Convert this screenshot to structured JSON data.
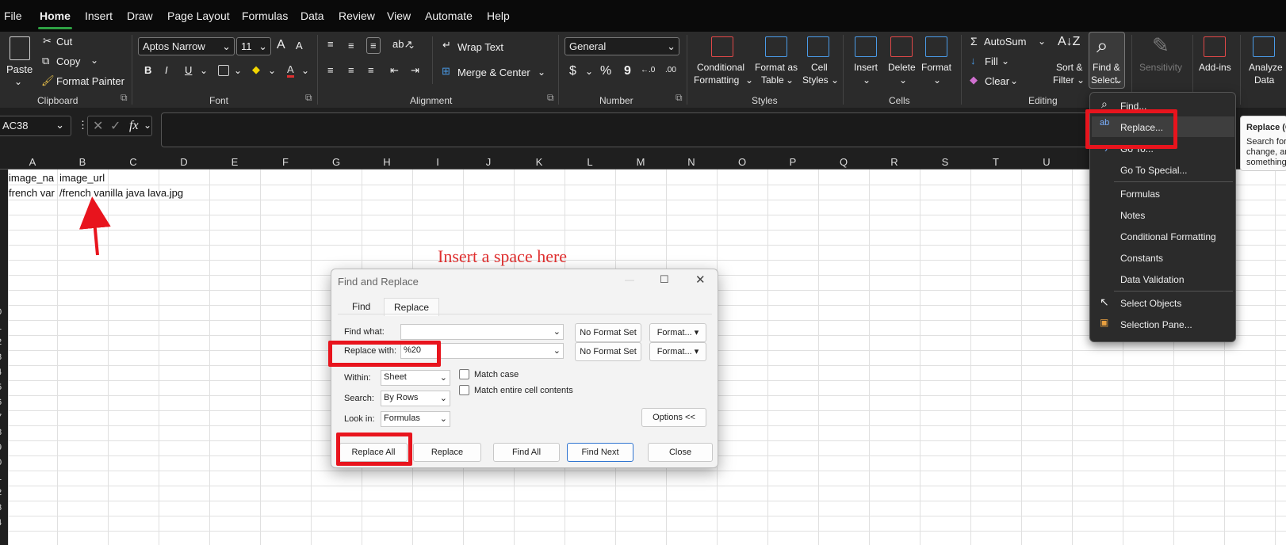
{
  "menu": [
    "File",
    "Home",
    "Insert",
    "Draw",
    "Page Layout",
    "Formulas",
    "Data",
    "Review",
    "View",
    "Automate",
    "Help"
  ],
  "clipboard": {
    "paste": "Paste",
    "cut": "Cut",
    "copy": "Copy",
    "format_painter": "Format Painter",
    "group": "Clipboard"
  },
  "font": {
    "name": "Aptos Narrow",
    "size": "11",
    "grow": "A",
    "shrink": "A",
    "bold": "B",
    "italic": "I",
    "underline": "U",
    "color": "A",
    "group": "Font"
  },
  "alignment": {
    "wrap": "Wrap Text",
    "merge": "Merge & Center",
    "group": "Alignment"
  },
  "number": {
    "format": "General",
    "currency": "$",
    "percent": "%",
    "comma": "9",
    "inc": "←.0",
    "dec": ".00",
    "group": "Number"
  },
  "styles": {
    "cond": "Conditional",
    "cond2": "Formatting",
    "table": "Format as",
    "table2": "Table",
    "cell": "Cell",
    "cell2": "Styles",
    "group": "Styles"
  },
  "cells": {
    "insert": "Insert",
    "delete": "Delete",
    "format": "Format",
    "group": "Cells"
  },
  "editing": {
    "autosum": "AutoSum",
    "fill": "Fill",
    "clear": "Clear",
    "sort": "Sort &",
    "sort2": "Filter",
    "find": "Find &",
    "find2": "Select",
    "group": "Editing"
  },
  "extras": {
    "sensitivity": "Sensitivity",
    "addins": "Add-ins",
    "analyze": "Analyze",
    "analyze2": "Data"
  },
  "namebox": "AC38",
  "fx": "fx",
  "columns": [
    "A",
    "B",
    "C",
    "D",
    "E",
    "F",
    "G",
    "H",
    "I",
    "J",
    "K",
    "L",
    "M",
    "N",
    "O",
    "P",
    "Q",
    "R",
    "S",
    "T",
    "U"
  ],
  "rows": [
    "",
    "",
    "",
    "",
    "",
    "",
    "",
    "",
    "",
    "0",
    "1",
    "2",
    "3",
    "4",
    "5",
    "6",
    "7",
    "8",
    "9",
    "0",
    "1",
    "2",
    "3",
    "4"
  ],
  "cells_data": {
    "a1": "image_na",
    "b1": "image_url",
    "a2": "french var",
    "b2": "/french vanilla java lava.jpg"
  },
  "annotation": "Insert a space here",
  "dialog": {
    "title": "Find and Replace",
    "tab_find": "Find",
    "tab_replace": "Replace",
    "find_label": "Find what:",
    "find_value": "",
    "replace_label": "Replace with:",
    "replace_value": "%20",
    "no_format": "No Format Set",
    "format_btn": "Format...",
    "within_label": "Within:",
    "within_value": "Sheet",
    "search_label": "Search:",
    "search_value": "By Rows",
    "lookin_label": "Look in:",
    "lookin_value": "Formulas",
    "match_case": "Match case",
    "match_entire": "Match entire cell contents",
    "options": "Options <<",
    "replace_all": "Replace All",
    "replace": "Replace",
    "find_all": "Find All",
    "find_next": "Find Next",
    "close": "Close"
  },
  "find_menu": {
    "items": [
      "Find...",
      "Replace...",
      "Go To...",
      "Go To Special...",
      "Formulas",
      "Notes",
      "Conditional Formatting",
      "Constants",
      "Data Validation",
      "Select Objects",
      "Selection Pane..."
    ]
  },
  "tooltip": {
    "title": "Replace (C",
    "body1": "Search for",
    "body2": "change, ar",
    "body3": "something"
  }
}
